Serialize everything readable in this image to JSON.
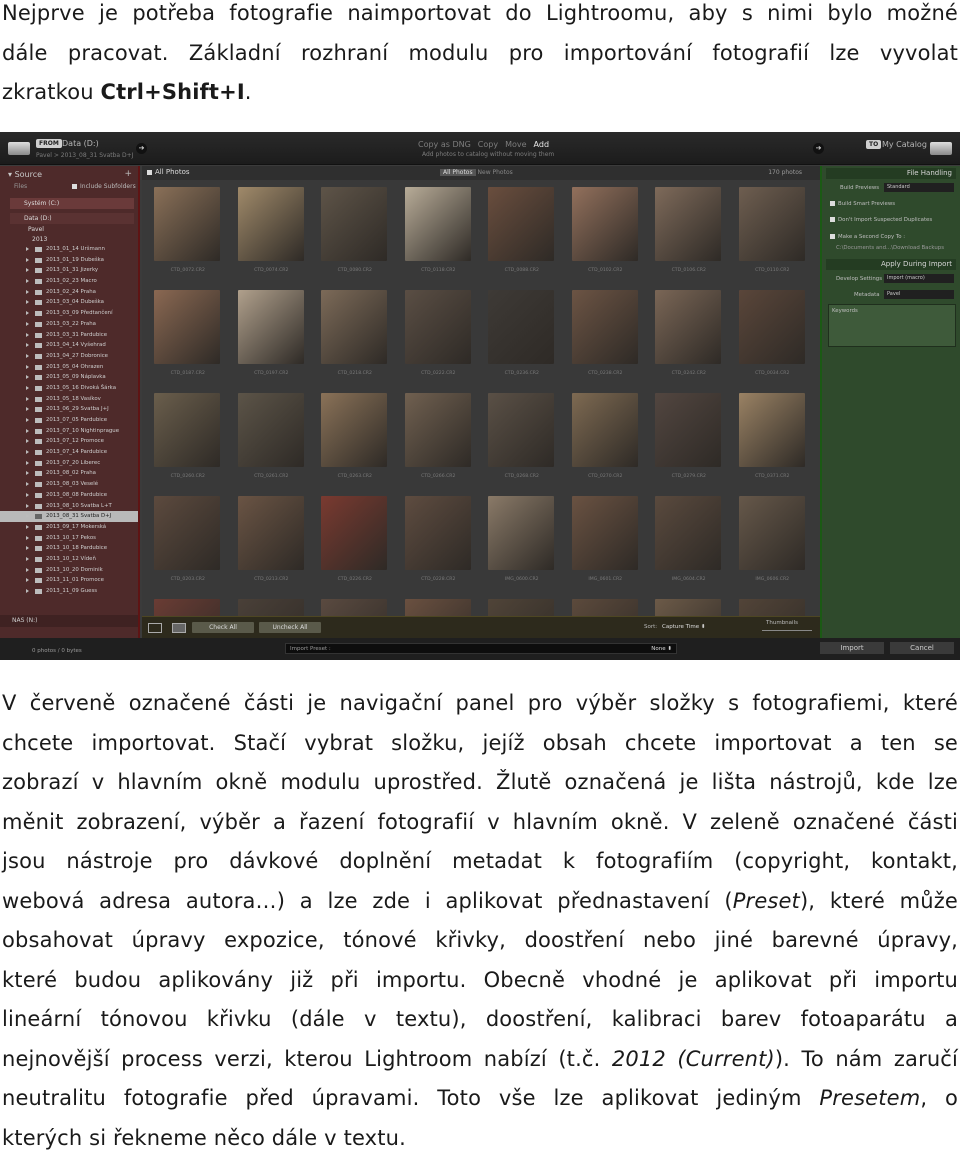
{
  "intro": {
    "line1": "Nejprve je potřeba fotografie naimportovat do Lightroomu, aby s nimi bylo možné",
    "line2": "dále pracovat. Základní rozhraní modulu pro importování fotografií lze vyvolat",
    "line3_pre": "zkratkou ",
    "shortcut": "Ctrl+Shift+I",
    "line3_post": "."
  },
  "screenshot": {
    "from_badge": "FROM",
    "from_source": "Data (D:)",
    "from_path": "Pavel > 2013_08_31 Svatba D+J",
    "modes": [
      "Copy as DNG",
      "Copy",
      "Move",
      "Add"
    ],
    "modes_active": "Add",
    "mode_description": "Add photos to catalog without moving them",
    "to_badge": "TO",
    "to_target": "My Catalog",
    "source_panel": {
      "title": "Source",
      "files_label": "Files",
      "include_subfolders": "Include Subfolders",
      "drive_system": "Systém (C:)",
      "drive_data": "Data (D:)",
      "user_folder": "Pavel",
      "year_folder": "2013",
      "folders": [
        "2013_01_14 Uršmann",
        "2013_01_19 Dubeška",
        "2013_01_31 Jizerky",
        "2013_02_23 Macro",
        "2013_02_24 Praha",
        "2013_03_04 Dubeška",
        "2013_03_09 Předtančení",
        "2013_03_22 Praha",
        "2013_03_31 Pardubice",
        "2013_04_14 Vyšehrad",
        "2013_04_27 Dobronice",
        "2013_05_04 Ohrazen",
        "2013_05_09 Náplavka",
        "2013_05_16 Divoká Šárka",
        "2013_05_18 Vasíkov",
        "2013_06_29 Svatba J+J",
        "2013_07_05 Pardubice",
        "2013_07_10 Nightinprague",
        "2013_07_12 Promoce",
        "2013_07_14 Pardubice",
        "2013_07_20 Liberec",
        "2013_08_02 Praha",
        "2013_08_03 Veselé",
        "2013_08_08 Pardubice",
        "2013_08_10 Svatba L+T",
        "2013_08_31 Svatba D+J",
        "2013_09_17 Mokerská",
        "2013_10_17 Pekos",
        "2013_10_18 Pardubice",
        "2013_10_12 Vídeň",
        "2013_10_20 Dominik",
        "2013_11_01 Promoce",
        "2013_11_09 Guess"
      ],
      "selected_index": 25,
      "nas": "NAS (N:)"
    },
    "grid_header": {
      "all_photos": "All Photos",
      "tab_all": "All Photos",
      "tab_new": "New Photos",
      "count": "170 photos"
    },
    "thumbs": [
      {
        "cap": "CTD_0072.CR2",
        "c": "#8a7058"
      },
      {
        "cap": "CTD_0074.CR2",
        "c": "#a08a6a"
      },
      {
        "cap": "CTD_0080.CR2",
        "c": "#5e5448"
      },
      {
        "cap": "CTD_0118.CR2",
        "c": "#b8ac98"
      },
      {
        "cap": "CTD_0088.CR2",
        "c": "#6a4e3e"
      },
      {
        "cap": "CTD_0102.CR2",
        "c": "#92705c"
      },
      {
        "cap": "CTD_0106.CR2",
        "c": "#7e6a5a"
      },
      {
        "cap": "CTD_0110.CR2",
        "c": "#6e5e50"
      },
      {
        "cap": "CTD_0187.CR2",
        "c": "#8a6852"
      },
      {
        "cap": "CTD_0197.CR2",
        "c": "#b0a08c"
      },
      {
        "cap": "CTD_0218.CR2",
        "c": "#7c6a58"
      },
      {
        "cap": "CTD_0222.CR2",
        "c": "#5a4e44"
      },
      {
        "cap": "CTD_0236.CR2",
        "c": "#3e3a36"
      },
      {
        "cap": "CTD_0238.CR2",
        "c": "#6c5444"
      },
      {
        "cap": "CTD_0242.CR2",
        "c": "#7a6656"
      },
      {
        "cap": "CTD_0034.CR2",
        "c": "#5a463a"
      },
      {
        "cap": "CTD_0260.CR2",
        "c": "#6a5e4c"
      },
      {
        "cap": "CTD_0261.CR2",
        "c": "#5c5448"
      },
      {
        "cap": "CTD_0263.CR2",
        "c": "#8a7258"
      },
      {
        "cap": "CTD_0266.CR2",
        "c": "#706050"
      },
      {
        "cap": "CTD_0268.CR2",
        "c": "#5a5046"
      },
      {
        "cap": "CTD_0270.CR2",
        "c": "#7e6a52"
      },
      {
        "cap": "CTD_0279.CR2",
        "c": "#524640"
      },
      {
        "cap": "CTD_0371.CR2",
        "c": "#9a8264"
      },
      {
        "cap": "CTD_0203.CR2",
        "c": "#5c4a3e"
      },
      {
        "cap": "CTD_0213.CR2",
        "c": "#6a5444"
      },
      {
        "cap": "CTD_0226.CR2",
        "c": "#7a3a30"
      },
      {
        "cap": "CTD_0228.CR2",
        "c": "#5e4c40"
      },
      {
        "cap": "IMG_0600.CR2",
        "c": "#8a7a68"
      },
      {
        "cap": "IMG_0601.CR2",
        "c": "#6a5242"
      },
      {
        "cap": "IMG_0604.CR2",
        "c": "#5a4a3e"
      },
      {
        "cap": "IMG_0606.CR2",
        "c": "#66584a"
      },
      {
        "cap": "",
        "c": "#6a3c34"
      },
      {
        "cap": "",
        "c": "#4a4038"
      },
      {
        "cap": "",
        "c": "#5a4a40"
      },
      {
        "cap": "",
        "c": "#6a5040"
      },
      {
        "cap": "",
        "c": "#504438"
      },
      {
        "cap": "",
        "c": "#5c4a3c"
      },
      {
        "cap": "",
        "c": "#6c5a48"
      },
      {
        "cap": "",
        "c": "#524438"
      }
    ],
    "right_panel": {
      "file_handling": "File Handling",
      "build_previews_label": "Build Previews",
      "build_previews_value": "Standard",
      "build_smart_previews": "Build Smart Previews",
      "dont_import_duplicates": "Don't Import Suspected Duplicates",
      "make_second_copy": "Make a Second Copy To :",
      "second_copy_path": "C:\\Documents and...\\Download Backups",
      "apply_during_import": "Apply During Import",
      "develop_settings_label": "Develop Settings",
      "develop_settings_value": "Import (macro)",
      "metadata_label": "Metadata",
      "metadata_value": "Pavel",
      "keywords_label": "Keywords"
    },
    "toolbar": {
      "check_all": "Check All",
      "uncheck_all": "Uncheck All",
      "sort_label": "Sort:",
      "sort_value": "Capture Time",
      "thumbnails_label": "Thumbnails"
    },
    "status": {
      "photo_count": "0 photos / 0 bytes",
      "import_preset_label": "Import Preset :",
      "import_preset_value": "None",
      "import_button": "Import",
      "cancel_button": "Cancel"
    }
  },
  "body": {
    "l1": "V červeně označené části je navigační panel pro výběr složky s fotografiemi, které",
    "l2": "chcete importovat. Stačí vybrat složku, jejíž obsah chcete importovat a ten se",
    "l3": "zobrazí v hlavním okně modulu uprostřed. Žlutě označená je lišta nástrojů, kde lze",
    "l4": "měnit zobrazení, výběr a řazení fotografií v hlavním okně. V zeleně označené části",
    "l5": "jsou nástroje pro dávkové doplnění metadat k fotografiím (copyright, kontakt,",
    "l6_pre": "webová adresa autora…) a lze zde i aplikovat přednastavení (",
    "l6_em": "Preset",
    "l6_post": "), které může",
    "l7": "obsahovat úpravy expozice, tónové křivky, doostření nebo jiné barevné úpravy,",
    "l8": "které budou aplikovány již při importu. Obecně vhodné je aplikovat při importu",
    "l9": "lineární tónovou křivku (dále v textu), doostření, kalibraci barev fotoaparátu a",
    "l10_pre": "nejnovější process verzi, kterou Lightroom nabízí (t.č. ",
    "l10_em": "2012 (Current)",
    "l10_post": "). To nám zaručí",
    "l11_pre": "neutralitu fotografie před úpravami. Toto vše lze aplikovat jediným ",
    "l11_em": "Presetem",
    "l11_post": ", o",
    "l12": "kterých si řekneme něco dále v textu."
  }
}
